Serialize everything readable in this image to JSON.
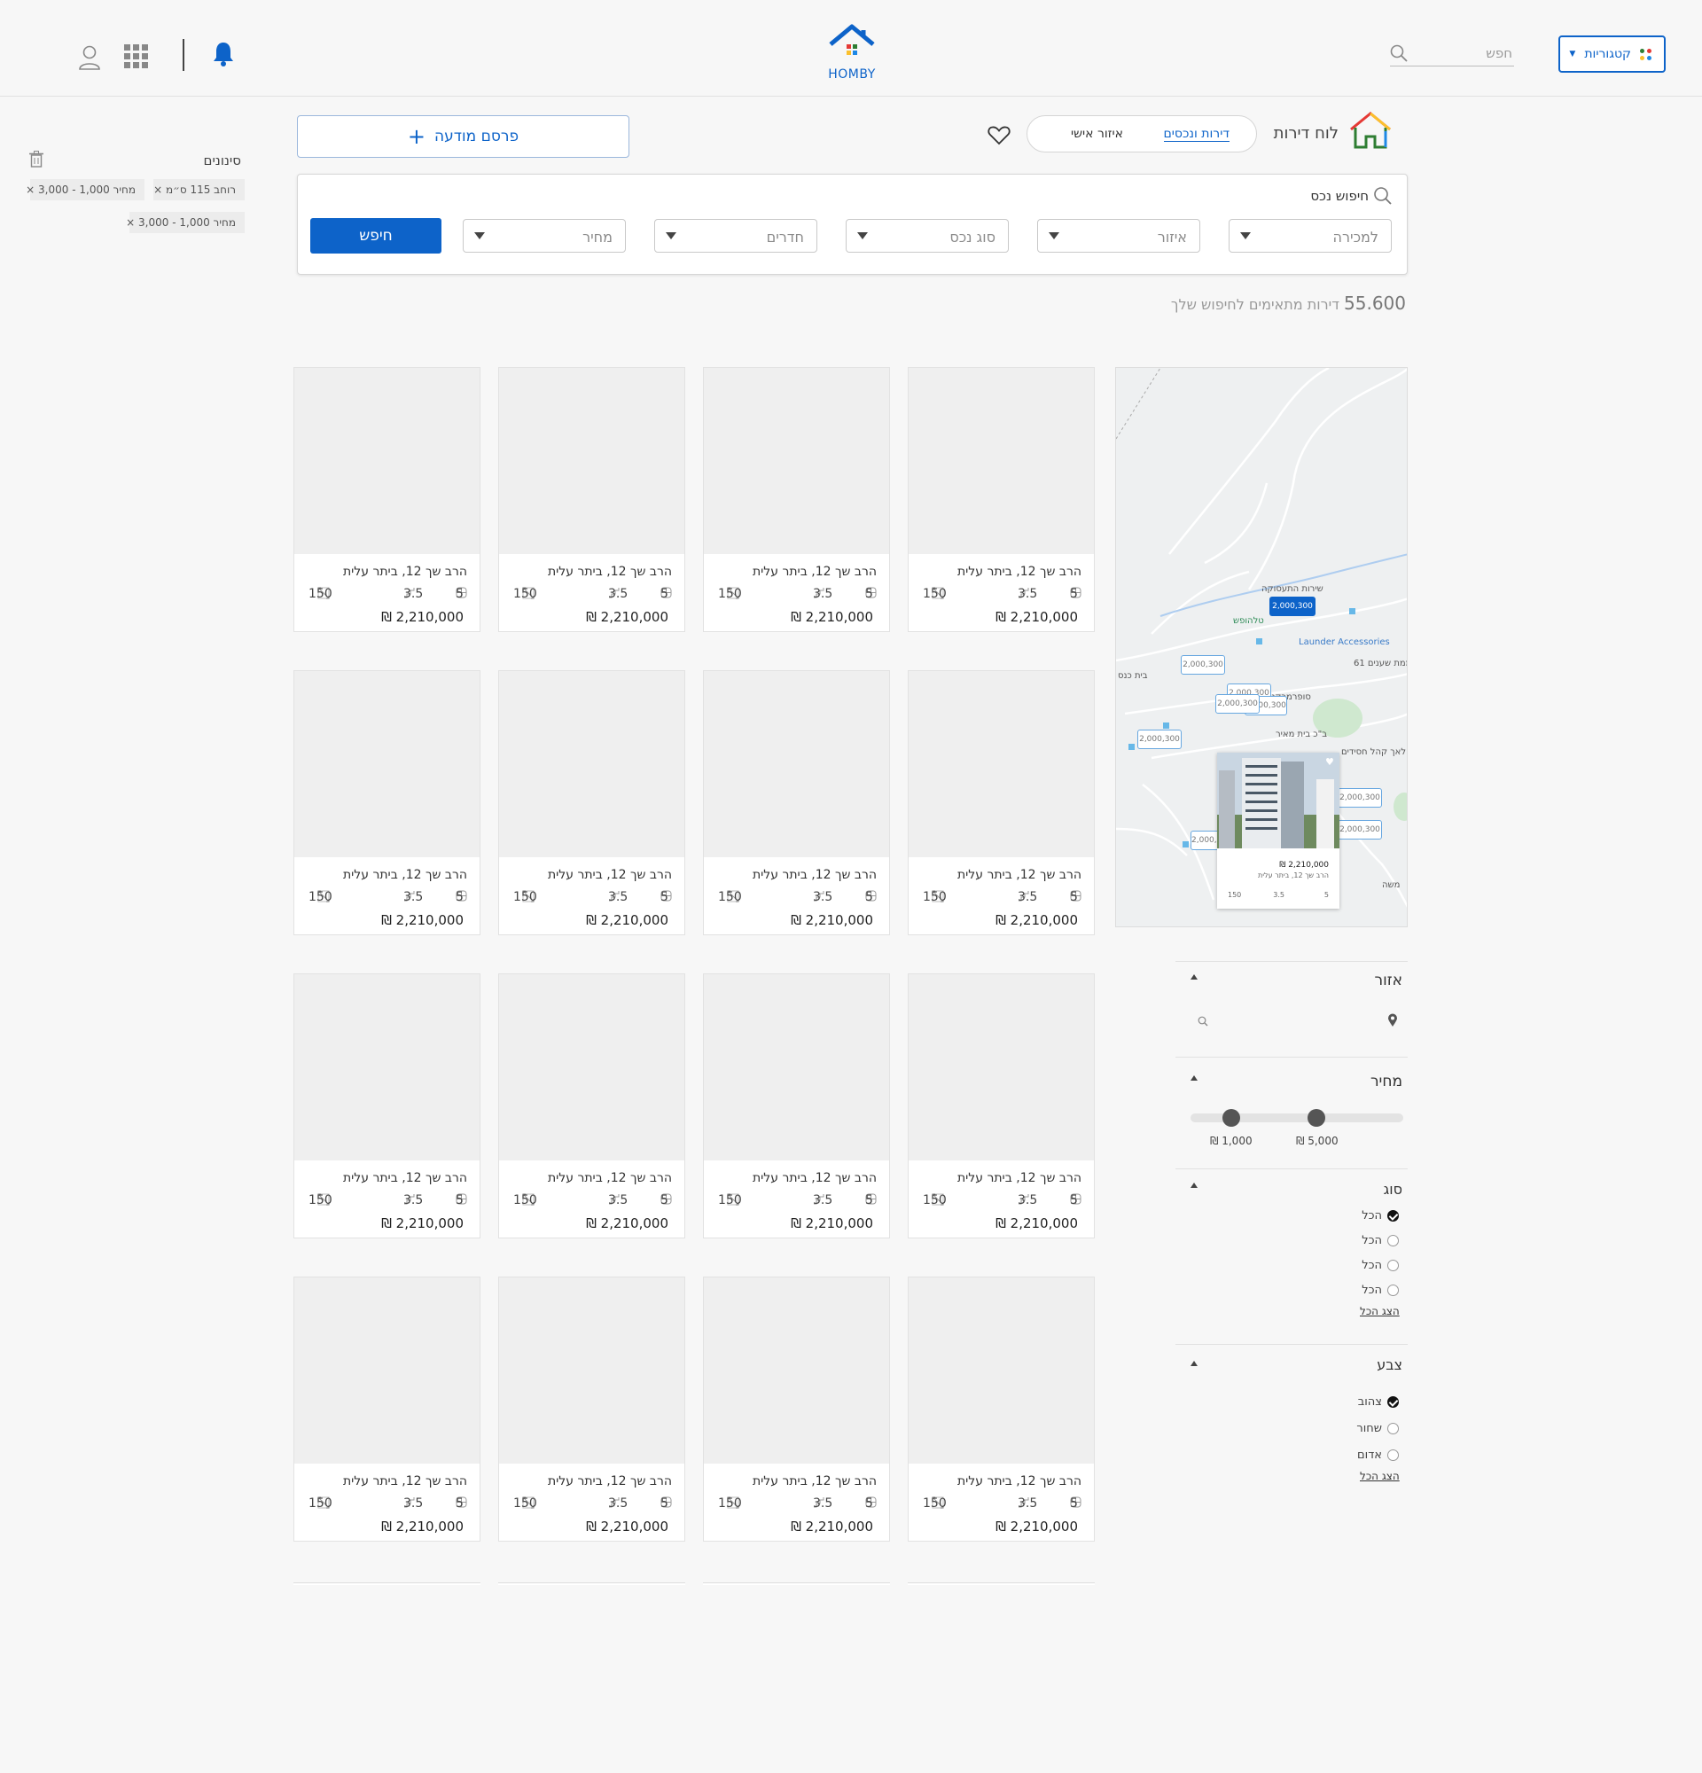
{
  "header": {
    "categories_label": "קטגוריות",
    "search_placeholder": "חפש",
    "logo_text": "HOMBY"
  },
  "toolbar": {
    "board_title": "לוח דירות",
    "tabs": [
      {
        "label": "דירות ונכסים",
        "active": true
      },
      {
        "label": "איזור אישי",
        "active": false
      }
    ],
    "post_ad_label": "פרסם מודעה"
  },
  "search": {
    "title": "חיפוש נכס",
    "fields": [
      {
        "placeholder": "למכירה"
      },
      {
        "placeholder": "איזור"
      },
      {
        "placeholder": "סוג נכס"
      },
      {
        "placeholder": "חדרים"
      },
      {
        "placeholder": "מחיר"
      }
    ],
    "submit_label": "חיפש"
  },
  "results": {
    "count": "55.600",
    "label": "דירות מתאימים לחיפוש שלך"
  },
  "active_filters": {
    "title": "סינונים",
    "chips_row1": [
      "רוחב 115 ס״מ",
      "מחיר 1,000 - 3,000"
    ],
    "chips_row2": [
      "מחיר 1,000 - 3,000"
    ]
  },
  "listing": {
    "address": "הרב שך 12, ביתר עלית",
    "rooms": "5",
    "floor": "3.5",
    "area": "150",
    "price": "2,210,000 ₪",
    "rows": 4,
    "cols": 4
  },
  "map": {
    "labels": [
      "שירות התעסוקה",
      "טלהופש",
      "Launder Accessories",
      "ממת שענים 61",
      "בית כנס",
      "סופרמרקט שפע",
      "ב\"כ בית מאיר",
      "לאך קהל חסידים",
      "משה"
    ],
    "pins": [
      "2,000,300",
      "2,000,300",
      "2,000,300",
      "2,000,300",
      "2,000,300",
      "2,000,300",
      "2,000,300",
      "2,000,300"
    ],
    "active_pin": "2,000,300",
    "popup": {
      "price": "2,210,000 ₪",
      "address": "הרב שך 12, ביתר עלית",
      "rooms": "5",
      "floor": "3.5",
      "area": "150"
    }
  },
  "filters": {
    "area": {
      "title": "אזור"
    },
    "price": {
      "title": "מחיר",
      "min_label": "1,000 ₪",
      "max_label": "5,000 ₪",
      "min_pos": 0.19,
      "max_pos": 0.59
    },
    "type": {
      "title": "סוג",
      "options": [
        {
          "label": "הכל",
          "checked": true
        },
        {
          "label": "הכל",
          "checked": false
        },
        {
          "label": "הכל",
          "checked": false
        },
        {
          "label": "הכל",
          "checked": false
        }
      ],
      "show_all": "הצג הכל"
    },
    "color": {
      "title": "צבע",
      "options": [
        {
          "label": "צהוב",
          "checked": true
        },
        {
          "label": "שחור",
          "checked": false
        },
        {
          "label": "אדום",
          "checked": false
        }
      ],
      "show_all": "הצג הכל"
    }
  },
  "colors": {
    "brand": "#0d63c9",
    "logo_dots": [
      "#e53935",
      "#2e7d32",
      "#1e88e5",
      "#fbc02d"
    ]
  }
}
